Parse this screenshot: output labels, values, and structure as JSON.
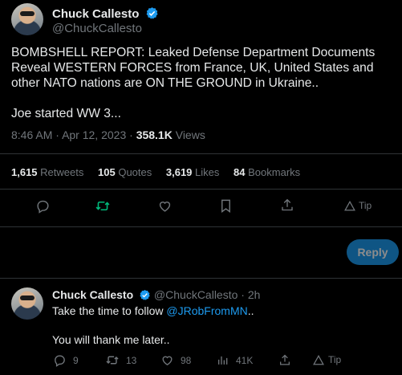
{
  "tweet": {
    "author_name": "Chuck Callesto",
    "author_handle": "@ChuckCallesto",
    "text_lines": [
      "BOMBSHELL REPORT: Leaked Defense Department Documents Reveal WESTERN FORCES from France, UK, United States and other NATO nations are ON THE GROUND in Ukraine..",
      "Joe started WW 3..."
    ],
    "time": "8:46 AM",
    "separator": "·",
    "date": "Apr 12, 2023",
    "views_count": "358.1K",
    "views_label": "Views"
  },
  "stats": {
    "retweets_count": "1,615",
    "retweets_label": "Retweets",
    "quotes_count": "105",
    "quotes_label": "Quotes",
    "likes_count": "3,619",
    "likes_label": "Likes",
    "bookmarks_count": "84",
    "bookmarks_label": "Bookmarks"
  },
  "actions": {
    "tip_label": "Tip",
    "reply_button_label": "Reply"
  },
  "reply": {
    "author_name": "Chuck Callesto",
    "author_handle": "@ChuckCallesto",
    "separator": "·",
    "time_ago": "2h",
    "text_before_mention": "Take the time to follow ",
    "mention": "@JRobFromMN",
    "text_after_mention": "..",
    "text_line2": "You will thank me later..",
    "replies_count": "9",
    "retweets_count": "13",
    "likes_count": "98",
    "views_count": "41K",
    "tip_label": "Tip"
  },
  "colors": {
    "background": "#000000",
    "text": "#e7e9ea",
    "muted": "#71767b",
    "accent": "#1d9bf0",
    "retweet_green": "#00ba7c",
    "divider": "#2f3336"
  },
  "icons": [
    "verified-badge-icon",
    "reply-icon",
    "retweet-icon",
    "like-icon",
    "bookmark-icon",
    "share-icon",
    "tip-icon",
    "views-icon"
  ]
}
